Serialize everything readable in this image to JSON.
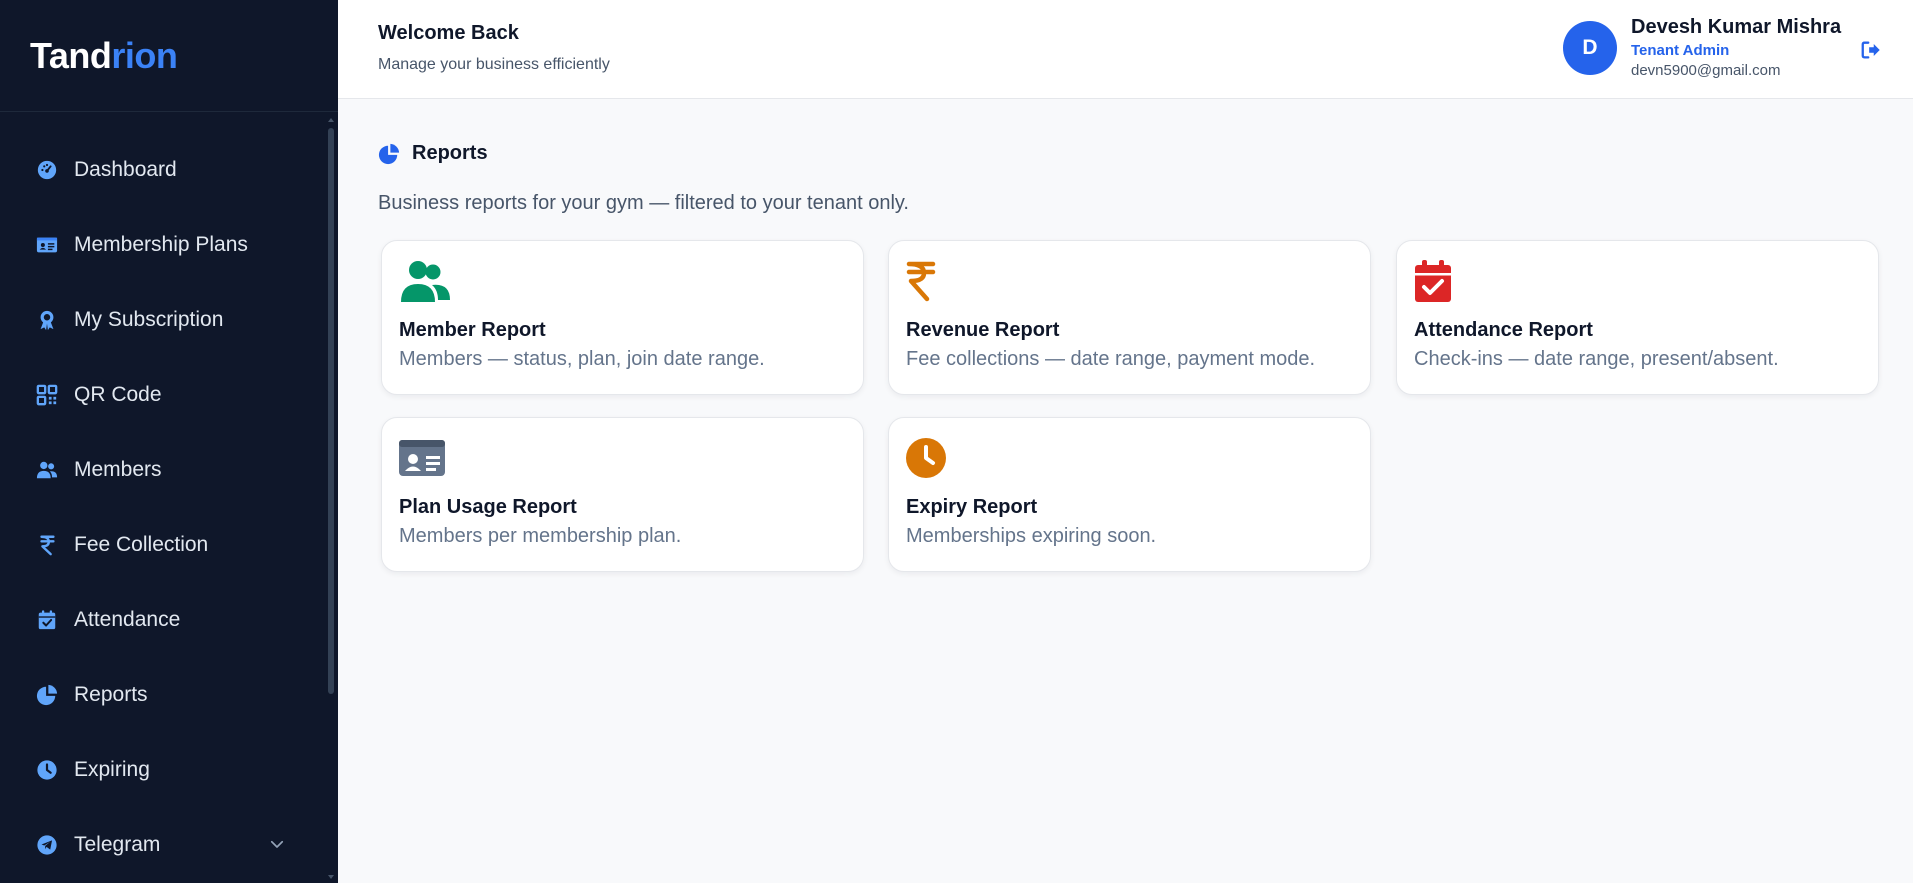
{
  "brand": {
    "part1": "Tand",
    "part2": "rion"
  },
  "sidebar": {
    "items": [
      {
        "label": "Dashboard",
        "icon": "dashboard-gauge-icon"
      },
      {
        "label": "Membership Plans",
        "icon": "id-card-icon"
      },
      {
        "label": "My Subscription",
        "icon": "award-ribbon-icon"
      },
      {
        "label": "QR Code",
        "icon": "qr-code-icon"
      },
      {
        "label": "Members",
        "icon": "users-icon"
      },
      {
        "label": "Fee Collection",
        "icon": "rupee-icon"
      },
      {
        "label": "Attendance",
        "icon": "calendar-check-icon"
      },
      {
        "label": "Reports",
        "icon": "pie-chart-icon"
      },
      {
        "label": "Expiring",
        "icon": "clock-icon"
      },
      {
        "label": "Telegram",
        "icon": "telegram-icon"
      }
    ]
  },
  "header": {
    "title": "Welcome Back",
    "subtitle": "Manage your business efficiently",
    "user": {
      "initial": "D",
      "name": "Devesh Kumar Mishra",
      "role": "Tenant Admin",
      "email": "devn5900@gmail.com"
    }
  },
  "main": {
    "title": "Reports",
    "description": "Business reports for your gym — filtered to your tenant only.",
    "cards": [
      {
        "title": "Member Report",
        "desc": "Members — status, plan, join date range.",
        "icon": "users-icon",
        "color": "#059669"
      },
      {
        "title": "Revenue Report",
        "desc": "Fee collections — date range, payment mode.",
        "icon": "rupee-icon",
        "color": "#d97706"
      },
      {
        "title": "Attendance Report",
        "desc": "Check-ins — date range, present/absent.",
        "icon": "calendar-check-icon",
        "color": "#dc2626"
      },
      {
        "title": "Plan Usage Report",
        "desc": "Members per membership plan.",
        "icon": "id-card-icon",
        "color": "#64748b"
      },
      {
        "title": "Expiry Report",
        "desc": "Memberships expiring soon.",
        "icon": "clock-icon",
        "color": "#d97706"
      }
    ]
  },
  "colors": {
    "sidebar_bg": "#0f172a",
    "accent": "#3b82f6",
    "primary": "#2563eb"
  }
}
